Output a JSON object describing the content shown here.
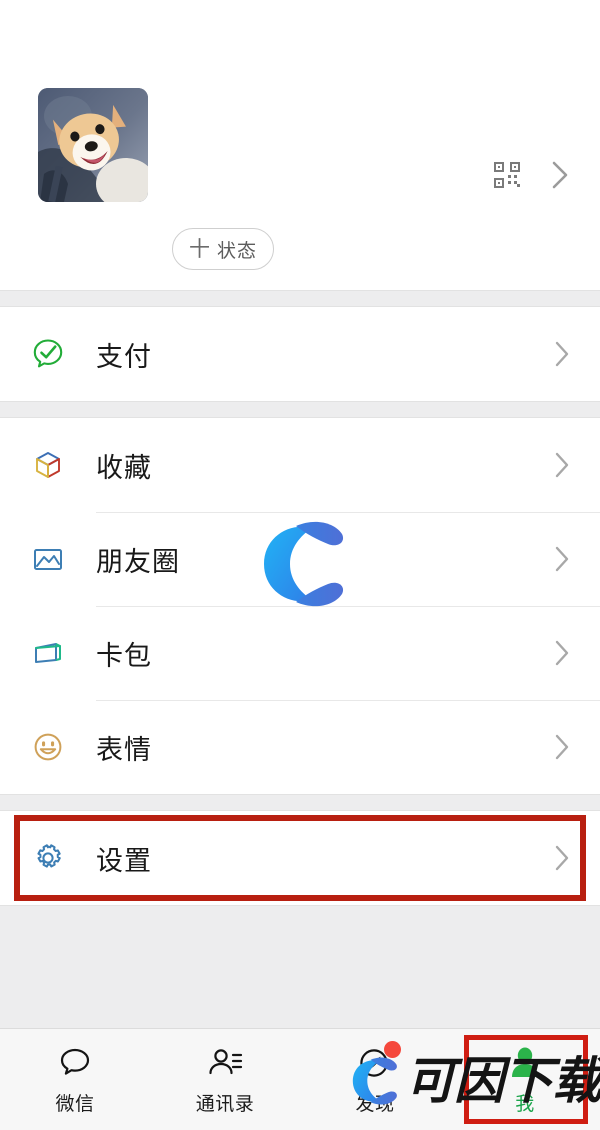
{
  "app": {
    "name": "微信",
    "screen_title": "我"
  },
  "profile": {
    "avatar_alt": "shiba-inu-dog-photo",
    "qr_icon": "qr-code-icon",
    "chevron_icon": "chevron-right-icon",
    "status_button": {
      "plus": "十",
      "label": "状态"
    }
  },
  "menu_groups": [
    {
      "items": [
        {
          "label": "支付",
          "icon": "pay-icon",
          "chevron": "chevron-right-icon"
        }
      ]
    },
    {
      "items": [
        {
          "label": "收藏",
          "icon": "favorites-cube-icon",
          "chevron": "chevron-right-icon"
        },
        {
          "label": "朋友圈",
          "icon": "moments-photo-icon",
          "chevron": "chevron-right-icon"
        },
        {
          "label": "卡包",
          "icon": "cards-wallet-icon",
          "chevron": "chevron-right-icon"
        },
        {
          "label": "表情",
          "icon": "stickers-smiley-icon",
          "chevron": "chevron-right-icon"
        }
      ]
    },
    {
      "highlighted": true,
      "items": [
        {
          "label": "设置",
          "icon": "settings-gear-icon",
          "chevron": "chevron-right-icon"
        }
      ]
    }
  ],
  "tabbar": {
    "tabs": [
      {
        "label": "微信",
        "icon": "chat-bubble-icon",
        "active": false,
        "badge": false
      },
      {
        "label": "通讯录",
        "icon": "contacts-icon",
        "active": false,
        "badge": false
      },
      {
        "label": "发现",
        "icon": "discover-compass-icon",
        "active": false,
        "badge": true
      },
      {
        "label": "我",
        "icon": "profile-person-icon",
        "active": true,
        "badge": false,
        "highlighted": true
      }
    ]
  },
  "watermarks": {
    "center_logo": "c-logo-watermark",
    "bottom_logo": "c-logo-watermark",
    "bottom_text": "可因下载"
  },
  "colors": {
    "pay_green": "#22ac38",
    "moments_blue": "#3d7eb4",
    "cards_blue": "#3d7eb4",
    "cards_green": "#1fb98a",
    "stickers_gold": "#cfa159",
    "settings_blue": "#3d7eb4",
    "cube_blue": "#3c6fb5",
    "cube_red": "#c0392b",
    "cube_yellow": "#d8b340",
    "highlight_red": "#b81f10",
    "tab_active_green": "#1aa34a",
    "badge_red": "#f5483c",
    "watermark_blue": "#2aa8f2",
    "watermark_blue_dark": "#3f6fdc"
  }
}
